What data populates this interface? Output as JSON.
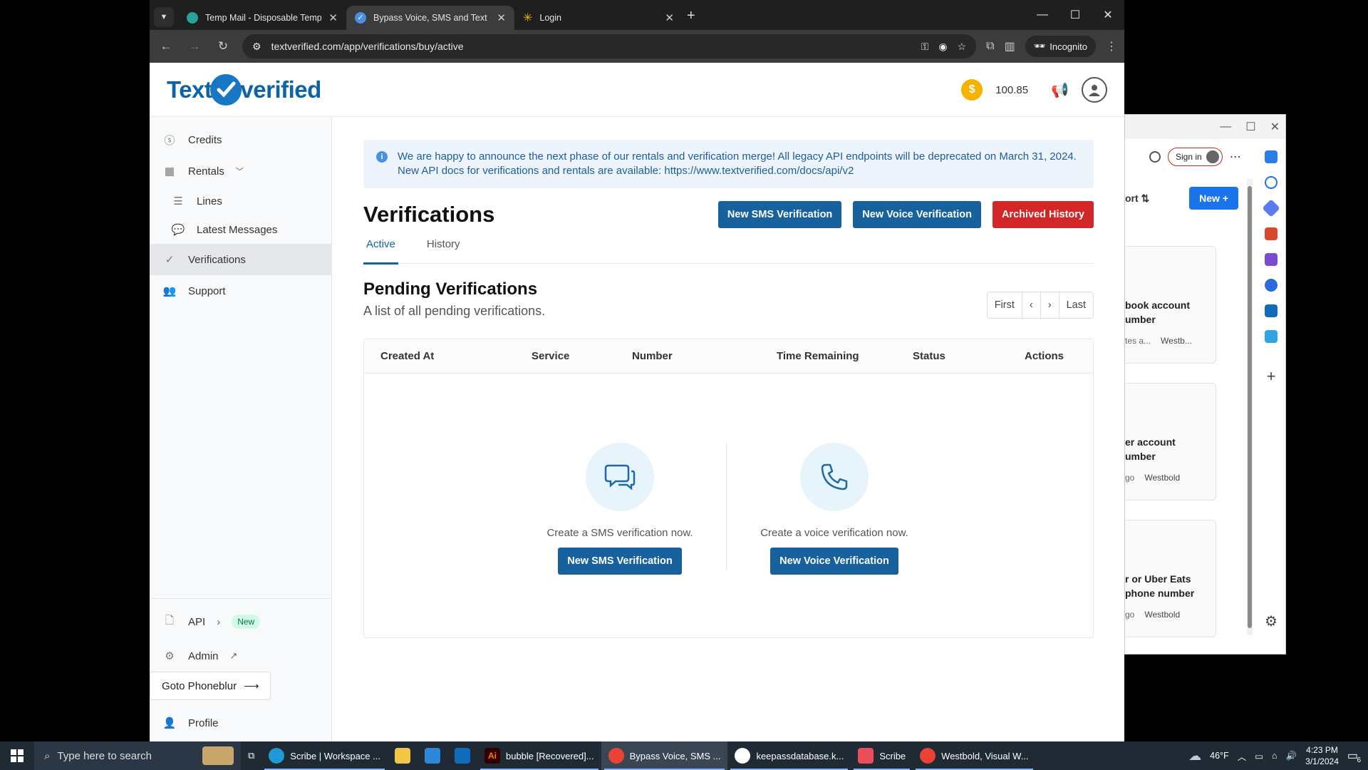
{
  "browser": {
    "tabs": [
      {
        "label": "Temp Mail - Disposable Tempor"
      },
      {
        "label": "Bypass Voice, SMS and Text Ver"
      },
      {
        "label": "Login"
      }
    ],
    "url": "textverified.com/app/verifications/buy/active",
    "incognito_label": "Incognito"
  },
  "header": {
    "logo_left": "Text",
    "logo_right": "verified",
    "balance": "100.85"
  },
  "sidebar": {
    "items": [
      {
        "label": "Credits"
      },
      {
        "label": "Rentals"
      },
      {
        "label": "Lines"
      },
      {
        "label": "Latest Messages"
      },
      {
        "label": "Verifications"
      },
      {
        "label": "Support"
      }
    ],
    "api_label": "API",
    "api_badge": "New",
    "admin_label": "Admin",
    "goto_label": "Goto Phoneblur",
    "profile_label": "Profile"
  },
  "main": {
    "alert_line1": "We are happy to announce the next phase of our rentals and verification merge! All legacy API endpoints will be deprecated on March 31, 2024.",
    "alert_line2": "New API docs for verifications and rentals are available: https://www.textverified.com/docs/api/v2",
    "title": "Verifications",
    "buttons": {
      "new_sms": "New SMS Verification",
      "new_voice": "New Voice Verification",
      "archived": "Archived History"
    },
    "tabs": [
      {
        "label": "Active"
      },
      {
        "label": "History"
      }
    ],
    "pending_title": "Pending Verifications",
    "pending_subtitle": "A list of all pending verifications.",
    "pager": {
      "first": "First",
      "prev": "‹",
      "next": "›",
      "last": "Last"
    },
    "columns": [
      "Created At",
      "Service",
      "Number",
      "Time Remaining",
      "Status",
      "Actions"
    ],
    "empty_sms_text": "Create a SMS verification now.",
    "empty_sms_button": "New SMS Verification",
    "empty_voice_text": "Create a voice verification now.",
    "empty_voice_button": "New Voice Verification"
  },
  "background_window": {
    "signin": "Sign in",
    "sort_label": "ort",
    "new_label": "New",
    "cards": [
      {
        "line1": "book account",
        "line2": "umber",
        "meta": "tes a...",
        "author": "Westb..."
      },
      {
        "line1": "er account",
        "line2": "umber",
        "meta": "go",
        "author": "Westbold"
      },
      {
        "line1": "r or Uber Eats",
        "line2": "phone number",
        "meta": "go",
        "author": "Westbold"
      }
    ]
  },
  "taskbar": {
    "search_placeholder": "Type here to search",
    "apps": [
      {
        "label": "Scribe | Workspace ..."
      },
      {
        "label": "bubble [Recovered]..."
      },
      {
        "label": "Bypass Voice, SMS ..."
      },
      {
        "label": "keepassdatabase.k..."
      },
      {
        "label": "Scribe"
      },
      {
        "label": "Westbold, Visual W..."
      }
    ],
    "weather": "46°F",
    "time": "4:23 PM",
    "date": "3/1/2024",
    "notifications": "6"
  },
  "colors": {
    "brand": "#17619e",
    "danger": "#d32626",
    "coin": "#f5b301"
  }
}
